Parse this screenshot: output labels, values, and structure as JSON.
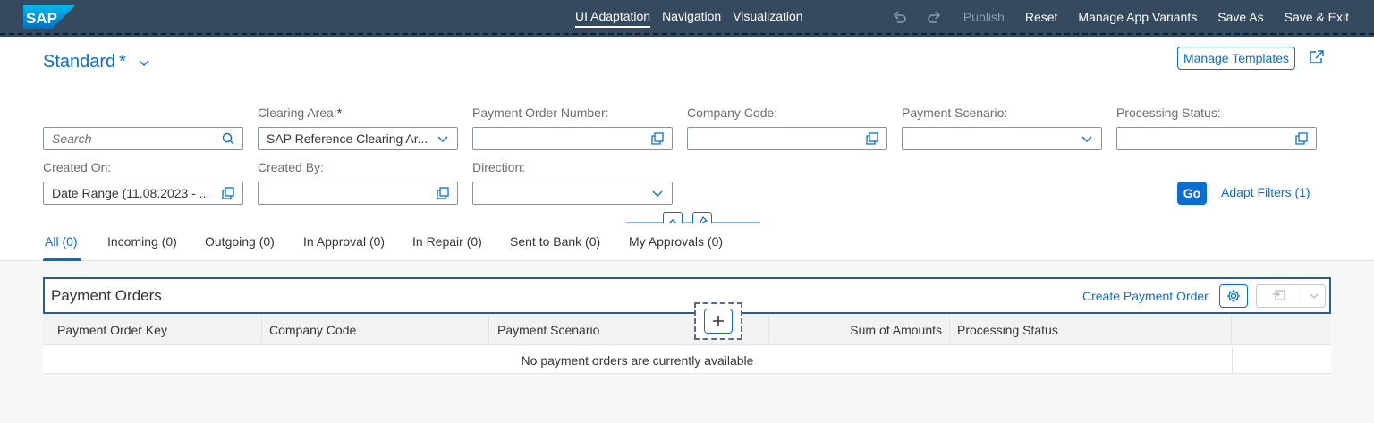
{
  "adaptation_bar": {
    "logo_text": "SAP",
    "modes": [
      "UI Adaptation",
      "Navigation",
      "Visualization"
    ],
    "active_mode": "UI Adaptation",
    "undo_icon": "undo-icon",
    "redo_icon": "redo-icon",
    "publish_label": "Publish",
    "reset_label": "Reset",
    "manage_app_variants_label": "Manage App Variants",
    "save_as_label": "Save As",
    "save_exit_label": "Save & Exit"
  },
  "header": {
    "variant_name": "Standard",
    "variant_modified_marker": "*",
    "manage_templates_label": "Manage Templates",
    "filters": {
      "search_placeholder": "Search",
      "clearing_area_label": "Clearing Area:",
      "clearing_area_required": "*",
      "clearing_area_value": "SAP Reference Clearing Ar...",
      "payment_order_number_label": "Payment Order Number:",
      "company_code_label": "Company Code:",
      "payment_scenario_label": "Payment Scenario:",
      "processing_status_label": "Processing Status:",
      "created_on_label": "Created On:",
      "created_on_value": "Date Range (11.08.2023 - ...",
      "created_by_label": "Created By:",
      "direction_label": "Direction:"
    },
    "go_label": "Go",
    "adapt_filters_label": "Adapt Filters (1)"
  },
  "tabs": [
    "All (0)",
    "Incoming (0)",
    "Outgoing (0)",
    "In Approval (0)",
    "In Repair (0)",
    "Sent to Bank (0)",
    "My Approvals (0)"
  ],
  "active_tab": "All (0)",
  "table": {
    "title": "Payment Orders",
    "create_label": "Create Payment Order",
    "columns": [
      "Payment Order Key",
      "Company Code",
      "Payment Scenario",
      "Sum of Amounts",
      "Processing Status"
    ],
    "no_data_text": "No payment orders are currently available"
  },
  "colors": {
    "shell": "#354a5f",
    "accent": "#0a6ed1",
    "required": "#bb0000"
  }
}
